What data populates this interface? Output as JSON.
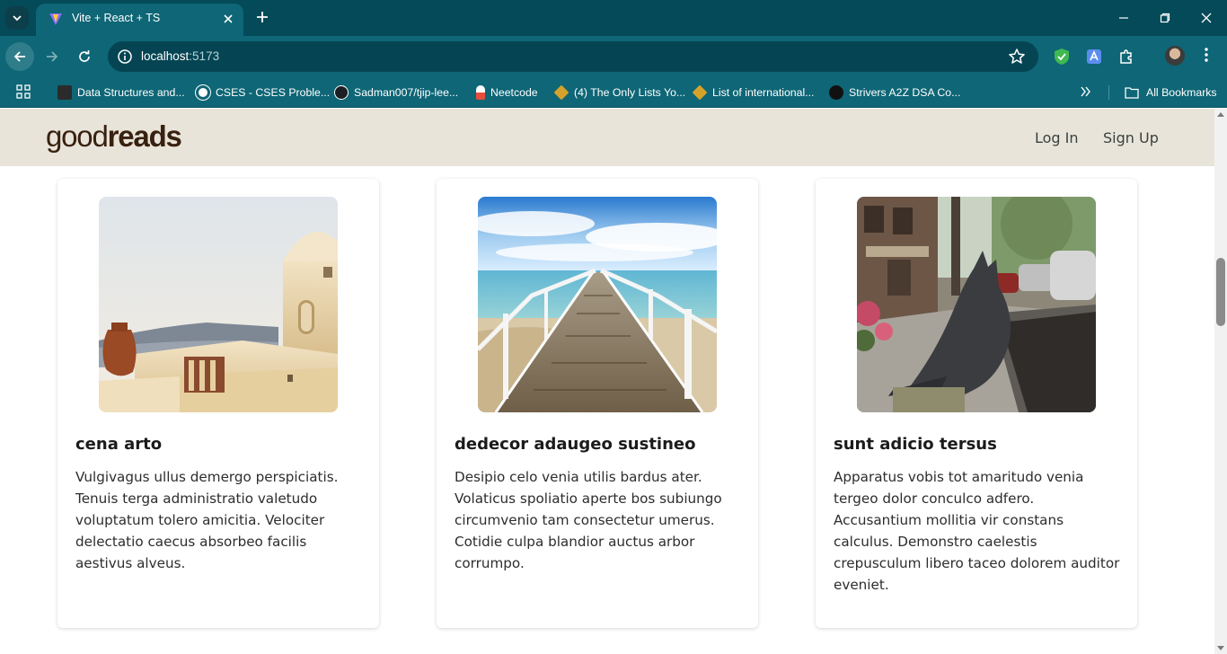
{
  "browser": {
    "tab_title": "Vite + React + TS",
    "url_host": "localhost",
    "url_port": ":5173",
    "bookmarks": [
      {
        "label": "Data Structures and...",
        "icon": "book-icon"
      },
      {
        "label": "CSES - CSES Proble...",
        "icon": "globe-icon"
      },
      {
        "label": "Sadman007/tjip-lee...",
        "icon": "github-icon"
      },
      {
        "label": "Neetcode",
        "icon": "neetcode-icon"
      },
      {
        "label": "(4) The Only Lists Yo...",
        "icon": "list-icon"
      },
      {
        "label": "List of international...",
        "icon": "list-icon"
      },
      {
        "label": "Strivers A2Z DSA Co...",
        "icon": "tuf-icon"
      }
    ],
    "all_bookmarks": "All Bookmarks"
  },
  "site": {
    "logo_light": "good",
    "logo_bold": "reads",
    "login": "Log In",
    "signup": "Sign Up"
  },
  "cards": [
    {
      "title": "cena arto",
      "text": "Vulgivagus ullus demergo perspiciatis. Tenuis terga administratio valetudo voluptatum tolero amicitia. Velociter delectatio caecus absorbeo facilis aestivus alveus.",
      "image": "santorini-whitewashed-building-photo"
    },
    {
      "title": "dedecor adaugeo sustineo",
      "text": "Desipio celo venia utilis bardus ater. Volaticus spoliatio aperte bos subiungo circumvenio tam consectetur umerus. Cotidie culpa blandior auctus arbor corrumpo.",
      "image": "wooden-pier-over-sea-photo"
    },
    {
      "title": "sunt adicio tersus",
      "text": "Apparatus vobis tot amaritudo venia tergeo dolor conculco adfero. Accusantium mollitia vir constans calculus. Demonstro caelestis crepusculum libero taceo dolorem auditor eveniet.",
      "image": "cat-statue-street-photo"
    }
  ],
  "colors": {
    "browser_frame": "#044a59",
    "browser_toolbar": "#0e6676",
    "site_header": "#e9e4d9",
    "logo": "#382110"
  }
}
